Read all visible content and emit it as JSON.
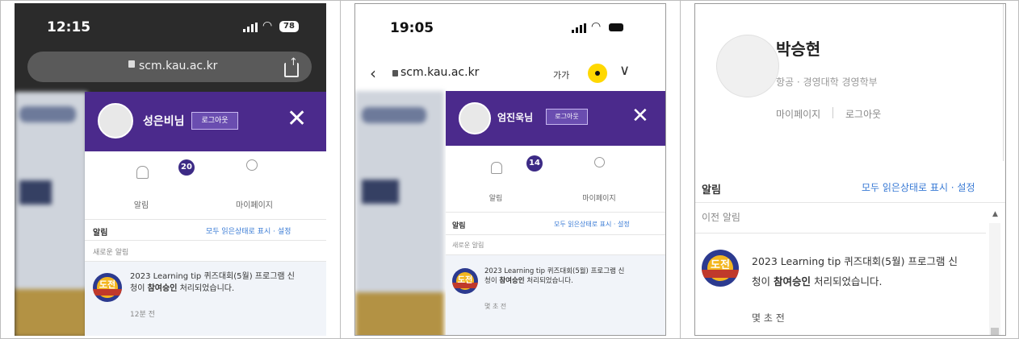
{
  "panels": [
    {
      "time": "12:15",
      "battery": "78",
      "url": "scm.kau.ac.kr",
      "user": "성은비님",
      "logout": "로그아웃",
      "badge": "20",
      "tab_alert": "알림",
      "tab_mypage": "마이페이지",
      "notif_header": "알림",
      "notif_actions": "모두 읽은상태로 표시 · 설정",
      "section_new": "새로운 알림",
      "message_line1": "2023 Learning tip 퀴즈대회(5월) 프로그램 신",
      "message_pre": "청이 ",
      "message_bold": "참여승인",
      "message_post": " 처리되었습니다.",
      "message_time": "12분 전"
    },
    {
      "time": "19:05",
      "url": "scm.kau.ac.kr",
      "size_label": "가가",
      "user": "엄진욱님",
      "logout": "로그아웃",
      "badge": "14",
      "tab_alert": "알림",
      "tab_mypage": "마이페이지",
      "notif_header": "알림",
      "notif_actions": "모두 읽은상태로 표시 · 설정",
      "section_new": "새로운 알림",
      "message_line1": "2023 Learning tip 퀴즈대회(5월) 프로그램 신",
      "message_pre": "청이 ",
      "message_bold": "참여승인",
      "message_post": " 처리되었습니다.",
      "message_time": "몇 초 전"
    },
    {
      "name": "박승현",
      "department": "항공 · 경영대학 경영학부",
      "mypage": "마이페이지",
      "logout": "로그아웃",
      "notif_header": "알림",
      "notif_actions": "모두 읽은상태로 표시 · 설정",
      "section_prev": "이전 알림",
      "message_line1": "2023 Learning tip 퀴즈대회(5월) 프로그램 신",
      "message_pre": "청이 ",
      "message_bold": "참여승인",
      "message_post": " 처리되었습니다.",
      "message_time": "몇 초 전"
    }
  ],
  "colors": {
    "purple": "#4b2a8c",
    "link": "#3a7bd5",
    "badge": "#3c2a85"
  }
}
